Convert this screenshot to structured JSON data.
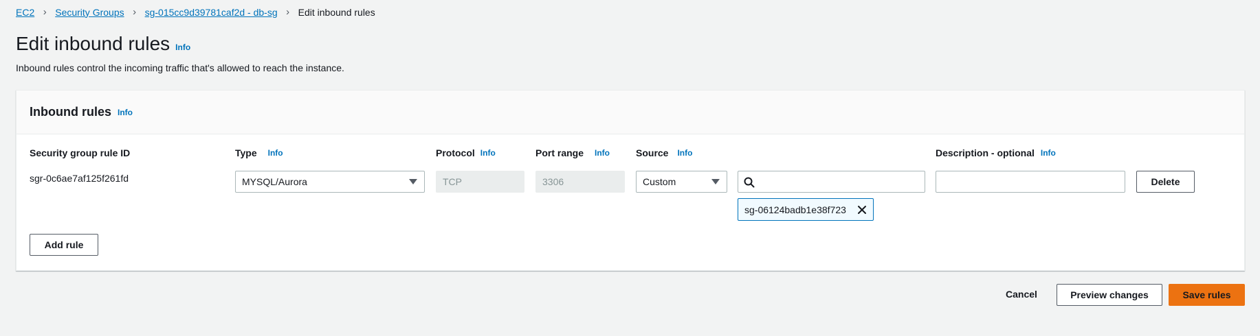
{
  "breadcrumb": {
    "items": [
      "EC2",
      "Security Groups",
      "sg-015cc9d39781caf2d - db-sg"
    ],
    "current": "Edit inbound rules"
  },
  "page": {
    "title": "Edit inbound rules",
    "info": "Info",
    "description": "Inbound rules control the incoming traffic that's allowed to reach the instance."
  },
  "panel": {
    "title": "Inbound rules",
    "info": "Info",
    "columns": {
      "rule_id": "Security group rule ID",
      "type": "Type",
      "protocol": "Protocol",
      "port_range": "Port range",
      "source": "Source",
      "description": "Description - optional",
      "info": "Info"
    },
    "rule": {
      "id": "sgr-0c6ae7af125f261fd",
      "type": "MYSQL/Aurora",
      "protocol": "TCP",
      "port_range": "3306",
      "source": "Custom",
      "search_value": "",
      "token": "sg-06124badb1e38f723",
      "description_value": "",
      "delete_label": "Delete"
    },
    "add_rule_label": "Add rule"
  },
  "footer": {
    "cancel_label": "Cancel",
    "preview_label": "Preview changes",
    "save_label": "Save rules"
  },
  "icons": {
    "breadcrumb_separator": "chevron-right-icon",
    "dropdown": "caret-down-icon",
    "search": "search-icon",
    "remove_token": "close-icon"
  },
  "colors": {
    "link": "#0073bb",
    "primary_button": "#ec7211",
    "background": "#f2f3f3"
  }
}
